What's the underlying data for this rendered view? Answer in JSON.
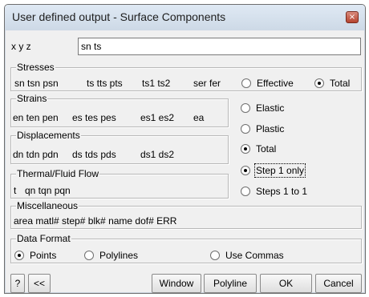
{
  "window": {
    "title": "User defined output - Surface Components",
    "close_icon": "×"
  },
  "xyz": {
    "label": "x y z",
    "value": "sn ts"
  },
  "stresses": {
    "title": "Stresses",
    "items": [
      "sn tsn psn",
      "ts tts pts",
      "ts1 ts2",
      "ser fer"
    ]
  },
  "stress_type": {
    "options": [
      {
        "label": "Effective",
        "checked": false
      },
      {
        "label": "Total",
        "checked": true
      }
    ]
  },
  "strains": {
    "title": "Strains",
    "items": [
      "en ten pen",
      "es tes pes",
      "es1 es2",
      "ea"
    ]
  },
  "displacements": {
    "title": "Displacements",
    "items": [
      "dn tdn pdn",
      "ds tds pds",
      "ds1 ds2"
    ]
  },
  "strain_type": {
    "options": [
      {
        "label": "Elastic",
        "checked": false
      },
      {
        "label": "Plastic",
        "checked": false
      },
      {
        "label": "Total",
        "checked": true
      }
    ]
  },
  "thermal": {
    "title": "Thermal/Fluid Flow",
    "items": [
      "t",
      "qn tqn pqn"
    ]
  },
  "step_type": {
    "options": [
      {
        "label": "Step 1 only",
        "checked": true
      },
      {
        "label": "Steps 1 to 1",
        "checked": false
      }
    ]
  },
  "misc": {
    "title": "Miscellaneous",
    "text": "area matl# step# blk# name dof# ERR"
  },
  "data_format": {
    "title": "Data Format",
    "options": [
      {
        "label": "Points",
        "checked": true
      },
      {
        "label": "Polylines",
        "checked": false
      },
      {
        "label": "Use Commas",
        "checked": false
      }
    ]
  },
  "buttons": {
    "help": "?",
    "back": "<<",
    "window": "Window",
    "polyline": "Polyline",
    "ok": "OK",
    "cancel": "Cancel"
  }
}
